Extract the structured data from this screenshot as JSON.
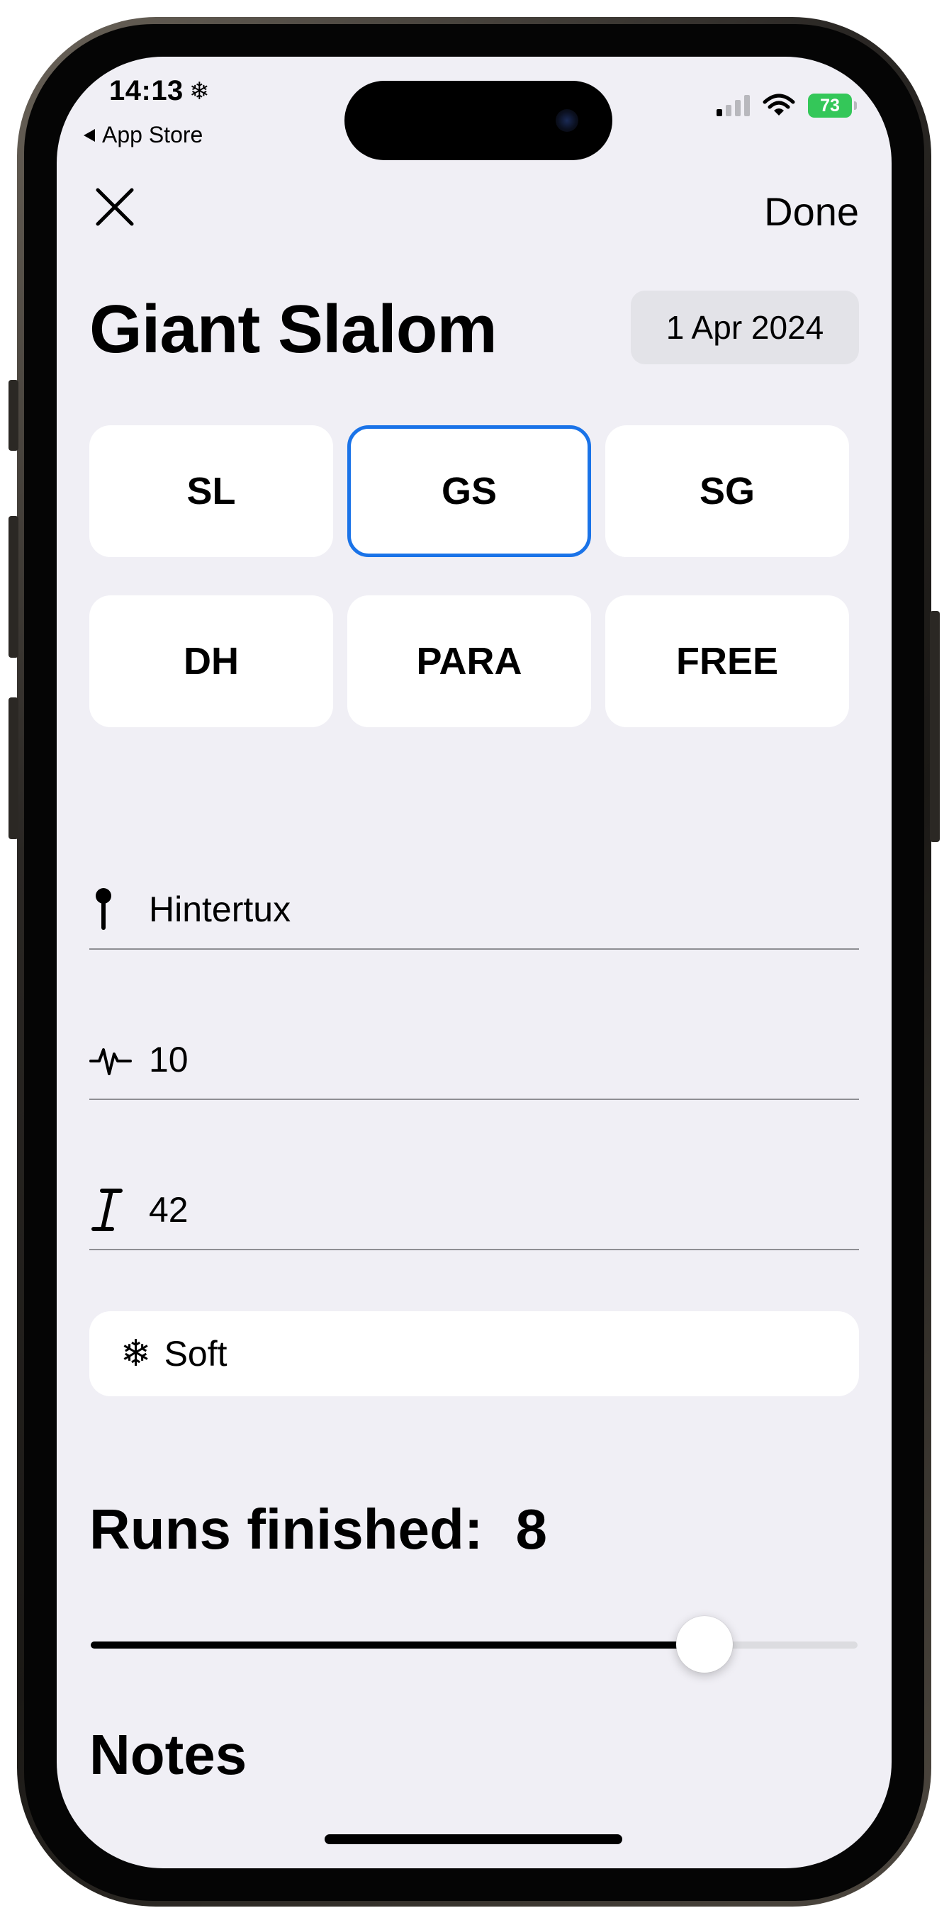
{
  "status_bar": {
    "time": "14:13",
    "time_glyph": "❄",
    "back_label": "App Store",
    "battery": "73"
  },
  "nav": {
    "close_icon": "close-icon",
    "done_label": "Done"
  },
  "header": {
    "title": "Giant Slalom",
    "date": "1 Apr 2024"
  },
  "disciplines": [
    {
      "label": "SL",
      "selected": false
    },
    {
      "label": "GS",
      "selected": true
    },
    {
      "label": "SG",
      "selected": false
    },
    {
      "label": "DH",
      "selected": false
    },
    {
      "label": "PARA",
      "selected": false
    },
    {
      "label": "FREE",
      "selected": false
    }
  ],
  "fields": {
    "location": {
      "icon": "pin-icon",
      "value": "Hintertux"
    },
    "gates": {
      "icon": "waveform-icon",
      "value": "10"
    },
    "vertical": {
      "icon": "italic-i-icon",
      "value": "42"
    }
  },
  "snow": {
    "icon": "snowflake-icon",
    "glyph": "❄",
    "label": "Soft"
  },
  "runs": {
    "label": "Runs finished:",
    "value": "8",
    "slider_fraction": 0.8
  },
  "notes": {
    "label": "Notes"
  },
  "colors": {
    "accent": "#1a73e8",
    "background": "#f0eff5",
    "battery": "#34c759"
  }
}
